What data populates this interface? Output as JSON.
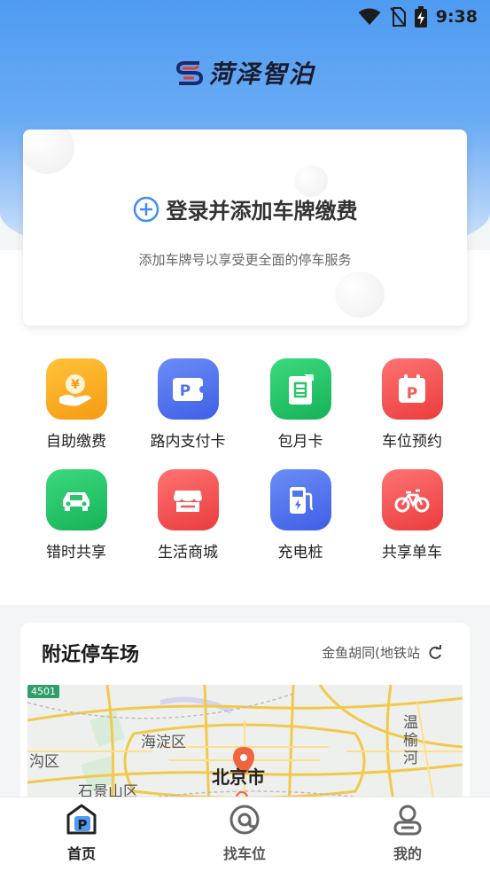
{
  "status_bar": {
    "time": "9:38"
  },
  "brand": {
    "name": "菏泽智泊"
  },
  "login_card": {
    "title": "登录并添加车牌缴费",
    "subtitle": "添加车牌号以享受更全面的停车服务"
  },
  "services": [
    {
      "label": "自助缴费",
      "icon": "coin-hand-icon"
    },
    {
      "label": "路内支付卡",
      "icon": "parking-ticket-icon"
    },
    {
      "label": "包月卡",
      "icon": "monthly-card-icon"
    },
    {
      "label": "车位预约",
      "icon": "parking-calendar-icon"
    },
    {
      "label": "错时共享",
      "icon": "car-icon"
    },
    {
      "label": "生活商城",
      "icon": "shop-icon"
    },
    {
      "label": "充电桩",
      "icon": "charging-pile-icon"
    },
    {
      "label": "共享单车",
      "icon": "bicycle-icon"
    }
  ],
  "nearby": {
    "title": "附近停车场",
    "location": "金鱼胡同(地铁站",
    "map": {
      "road_shield": "4501",
      "labels": {
        "haidian": "海淀区",
        "beijing": "北京市",
        "shijingshan": "石景山区",
        "mentougou": "沟区",
        "wenyu": "温",
        "wenyu2": "榆",
        "wenyu3": "河"
      }
    }
  },
  "tabbar": {
    "tabs": [
      {
        "label": "首页",
        "icon": "home-parking-icon",
        "active": true
      },
      {
        "label": "找车位",
        "icon": "search-location-icon",
        "active": false
      },
      {
        "label": "我的",
        "icon": "user-icon",
        "active": false
      }
    ]
  },
  "colors": {
    "accent_blue": "#3f8ef2",
    "tile_orange": "#f8a91a",
    "tile_blue": "#4f74f0",
    "tile_green": "#2bc66b",
    "tile_red": "#f25a5a",
    "map_pin": "#f0643f"
  }
}
